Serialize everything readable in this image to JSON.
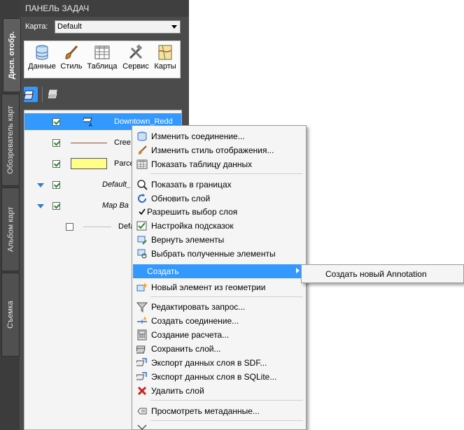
{
  "pane": {
    "title": "ПАНЕЛЬ ЗАДАЧ",
    "vertical_tabs": [
      {
        "label": "Дисп. отобр.",
        "active": true
      },
      {
        "label": "Обозреватель карт",
        "active": false
      },
      {
        "label": "Альбом карт",
        "active": false
      },
      {
        "label": "Съемка",
        "active": false
      }
    ],
    "map_label": "Карта:",
    "map_value": "Default",
    "toolbar": [
      {
        "label": "Данные",
        "icon": "database-icon"
      },
      {
        "label": "Стиль",
        "icon": "brush-icon"
      },
      {
        "label": "Таблица",
        "icon": "table-icon"
      },
      {
        "label": "Сервис",
        "icon": "tools-icon"
      },
      {
        "label": "Карты",
        "icon": "map-icon"
      }
    ]
  },
  "layers": [
    {
      "label": "Downtown_Redd",
      "checked": true,
      "selected": true
    },
    {
      "label": "Cree",
      "checked": true,
      "selected": false
    },
    {
      "label": "Parce",
      "checked": true,
      "selected": false
    },
    {
      "label": "Default_",
      "checked": true,
      "selected": false,
      "group": true
    },
    {
      "label": "Map Ba",
      "checked": true,
      "selected": false,
      "group": true
    },
    {
      "label": "Defa",
      "checked": false,
      "selected": false
    }
  ],
  "context_menu": {
    "items": [
      "Изменить соединение...",
      "Изменить стиль отображения...",
      "Показать таблицу данных",
      "Показать в границах",
      "Обновить слой",
      "Разрешить выбор слоя",
      "Настройка подсказок",
      "Вернуть элементы",
      "Выбрать полученные элементы",
      "Создать",
      "Новый элемент из геометрии",
      "Редактировать запрос...",
      "Создать соединение...",
      "Создание расчета...",
      "Сохранить слой...",
      "Экспорт данных слоя в SDF...",
      "Экспорт данных слоя в SQLite...",
      "Удалить слой",
      "Просмотреть метаданные..."
    ],
    "highlighted": "Создать",
    "submenu_item": "Создать новый Annotation"
  },
  "colors": {
    "selection": "#3399ff",
    "pane_bg": "#4b4b4b"
  }
}
